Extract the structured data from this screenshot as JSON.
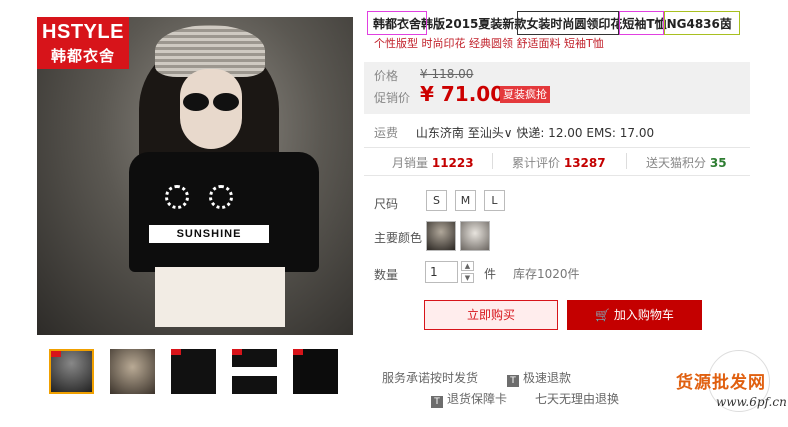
{
  "brand": {
    "name_en": "HSTYLE",
    "name_cn": "韩都衣舍"
  },
  "main_image": {
    "print_text": "SUNSHINE"
  },
  "product": {
    "title": "韩都衣舍韩版2015夏装新款女装时尚圆领印花短袖T恤NG4836茵",
    "subtitle": "个性版型 时尚印花 经典圆领 舒适面料 短袖T恤"
  },
  "price": {
    "orig_label": "价格",
    "orig_value": "¥ 118.00",
    "promo_label": "促销价",
    "promo_value": "¥ 71.00",
    "promo_badge": "夏装疯抢"
  },
  "shipping": {
    "label": "运费",
    "from": "山东济南",
    "to": "至汕头",
    "express": "快递: 12.00",
    "ems": "EMS: 17.00"
  },
  "stats": {
    "monthly_label": "月销量",
    "monthly_value": "11223",
    "reviews_label": "累计评价",
    "reviews_value": "13287",
    "points_label": "送天猫积分",
    "points_value": "35"
  },
  "size": {
    "label": "尺码",
    "options": [
      "S",
      "M",
      "L"
    ]
  },
  "color": {
    "label": "主要颜色"
  },
  "quantity": {
    "label": "数量",
    "value": "1",
    "unit": "件",
    "stock": "库存1020件"
  },
  "actions": {
    "buy_now": "立即购买",
    "add_cart": "加入购物车"
  },
  "services": {
    "label": "服务承诺",
    "items": [
      "按时发货",
      "极速退款",
      "退货保障卡",
      "七天无理由退换"
    ]
  },
  "watermark": {
    "text": "货源批发网",
    "url": "www.6pf.cn"
  },
  "colors": {
    "accent": "#c40000",
    "price": "#cc0000",
    "stats_red": "#c40000",
    "stats_green": "#2e7d32"
  }
}
